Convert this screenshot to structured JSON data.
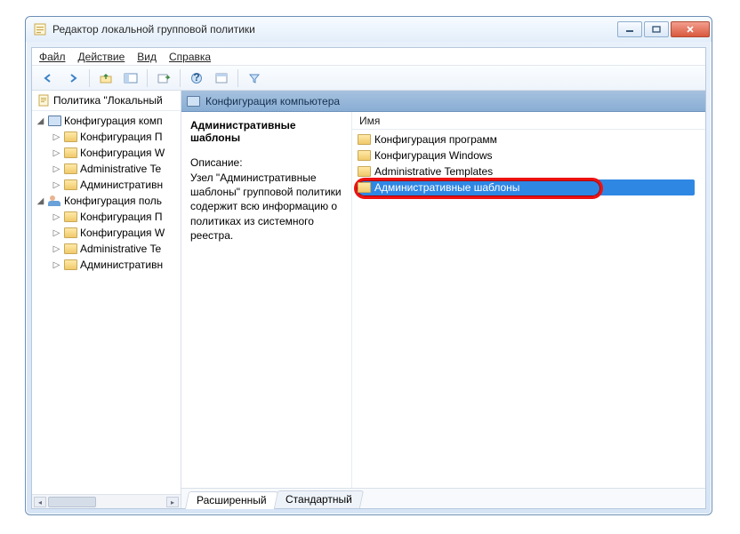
{
  "window": {
    "title": "Редактор локальной групповой политики"
  },
  "menu": {
    "file": "Файл",
    "action": "Действие",
    "view": "Вид",
    "help": "Справка"
  },
  "tree": {
    "root": "Политика \"Локальный",
    "comp_config": "Конфигурация комп",
    "comp_sw": "Конфигурация П",
    "comp_win": "Конфигурация W",
    "comp_admin_en": "Administrative Te",
    "comp_admin_ru": "Административн",
    "user_config": "Конфигурация поль",
    "user_sw": "Конфигурация П",
    "user_win": "Конфигурация W",
    "user_admin_en": "Administrative Te",
    "user_admin_ru": "Административн"
  },
  "header": {
    "title": "Конфигурация компьютера"
  },
  "description": {
    "title": "Административные шаблоны",
    "label": "Описание:",
    "text": "Узел \"Административные шаблоны\" групповой политики содержит всю информацию о политиках из системного реестра."
  },
  "list": {
    "column": "Имя",
    "items": [
      "Конфигурация программ",
      "Конфигурация Windows",
      "Administrative Templates",
      "Административные шаблоны"
    ]
  },
  "tabs": {
    "extended": "Расширенный",
    "standard": "Стандартный"
  }
}
